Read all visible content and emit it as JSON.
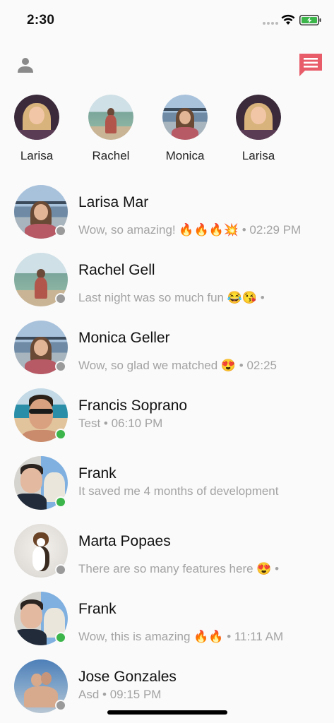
{
  "status_bar": {
    "time": "2:30"
  },
  "header": {
    "profile_icon": "person-icon",
    "compose_icon": "compose-message-icon",
    "accent_color": "#e85c6a"
  },
  "stories": [
    {
      "name": "Larisa"
    },
    {
      "name": "Rachel"
    },
    {
      "name": "Monica"
    },
    {
      "name": "Larisa"
    }
  ],
  "conversations": [
    {
      "name": "Larisa Mar",
      "message": "Wow, so amazing! 🔥🔥🔥💥 • 02:29 PM",
      "status": "offline"
    },
    {
      "name": "Rachel Gell",
      "message": "Last night was so much fun 😂😘 •",
      "status": "offline"
    },
    {
      "name": "Monica Geller",
      "message": "Wow, so glad we matched 😍 • 02:25",
      "status": "offline"
    },
    {
      "name": "Francis Soprano",
      "message": "Test • 06:10 PM",
      "status": "online"
    },
    {
      "name": "Frank",
      "message": "It saved me 4 months of development",
      "status": "online"
    },
    {
      "name": "Marta Popaes",
      "message": "There are so many features here 😍 •",
      "status": "offline"
    },
    {
      "name": "Frank",
      "message": "Wow, this is amazing 🔥🔥 • 11:11 AM",
      "status": "online"
    },
    {
      "name": "Jose Gonzales",
      "message": "Asd • 09:15 PM",
      "status": "offline"
    }
  ],
  "colors": {
    "online": "#3cb64a",
    "offline": "#9a9a9a",
    "secondary_text": "#a3a3a3"
  }
}
